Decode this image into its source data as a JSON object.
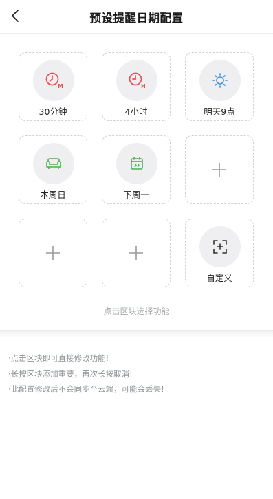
{
  "header": {
    "title": "预设提醒日期配置",
    "back_icon": "chevron-left-icon"
  },
  "tiles": [
    {
      "label": "30分钟",
      "icon": "clock-m-icon",
      "color": "#e05252"
    },
    {
      "label": "4小时",
      "icon": "clock-h-icon",
      "color": "#e05252"
    },
    {
      "label": "明天9点",
      "icon": "sun-icon",
      "color": "#3b8fe0"
    },
    {
      "label": "本周日",
      "icon": "sofa-icon",
      "color": "#4fae52"
    },
    {
      "label": "下周一",
      "icon": "calendar-next-icon",
      "color": "#4fae52"
    },
    {
      "label": "",
      "icon": "plus-icon"
    },
    {
      "label": "",
      "icon": "plus-icon"
    },
    {
      "label": "",
      "icon": "plus-icon"
    },
    {
      "label": "自定义",
      "icon": "custom-add-icon",
      "color": "#333333"
    }
  ],
  "hint": "点击区块选择功能",
  "notes": [
    "·点击区块即可直接修改功能!",
    "·长按区块添加重要，再次长按取消!",
    "·此配置修改后不会同步至云端，可能会丢失!"
  ]
}
